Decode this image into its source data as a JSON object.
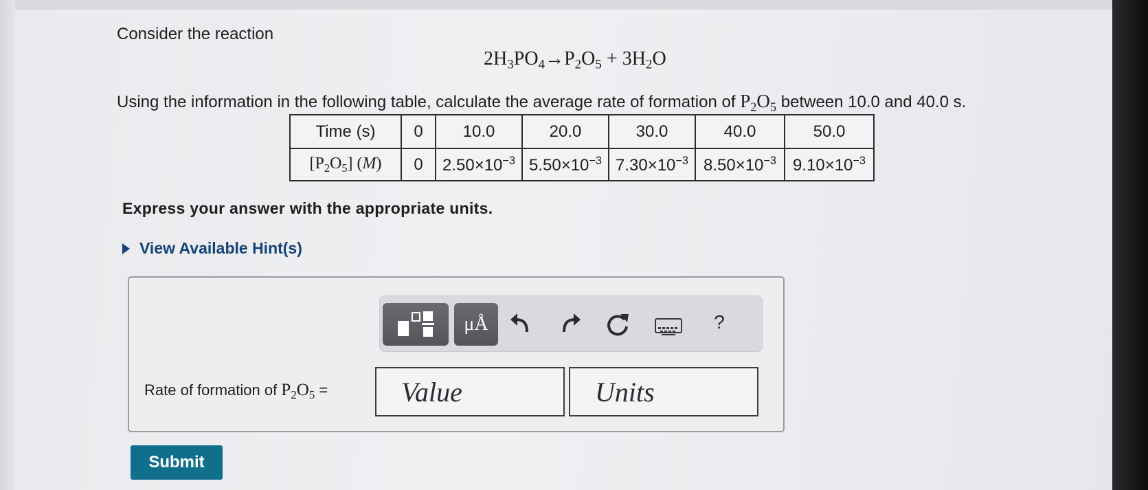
{
  "problem": {
    "intro": "Consider the reaction",
    "equation": "2H3PO4→P2O5 + 3H2O",
    "question_prefix": "Using the information in the following table, calculate the average rate of formation of ",
    "species": "P2O5",
    "question_suffix": " between 10.0 and 40.0 s.",
    "express": "Express your answer with the appropriate units.",
    "hints_label": "View Available Hint(s)"
  },
  "table": {
    "row1_header": "Time (s)",
    "row2_header": "[P2O5] (M)",
    "times": [
      "0",
      "10.0",
      "20.0",
      "30.0",
      "40.0",
      "50.0"
    ],
    "concentrations": [
      {
        "text": "0",
        "exp": ""
      },
      {
        "text": "2.50×10",
        "exp": "−3"
      },
      {
        "text": "5.50×10",
        "exp": "−3"
      },
      {
        "text": "7.30×10",
        "exp": "−3"
      },
      {
        "text": "8.50×10",
        "exp": "−3"
      },
      {
        "text": "9.10×10",
        "exp": "−3"
      }
    ]
  },
  "toolbar": {
    "templates_icon": "templates-icon",
    "units_label": "μÅ",
    "undo_icon": "undo-icon",
    "redo_icon": "redo-icon",
    "reset_icon": "reset-icon",
    "keyboard_icon": "keyboard-icon",
    "help_label": "?"
  },
  "answer": {
    "label": "Rate of formation of P2O5 =",
    "value_placeholder": "Value",
    "units_placeholder": "Units"
  },
  "submit_label": "Submit",
  "colors": {
    "link": "#14437a",
    "submit": "#0f6f8d",
    "toolbar_button": "#5f6065"
  }
}
